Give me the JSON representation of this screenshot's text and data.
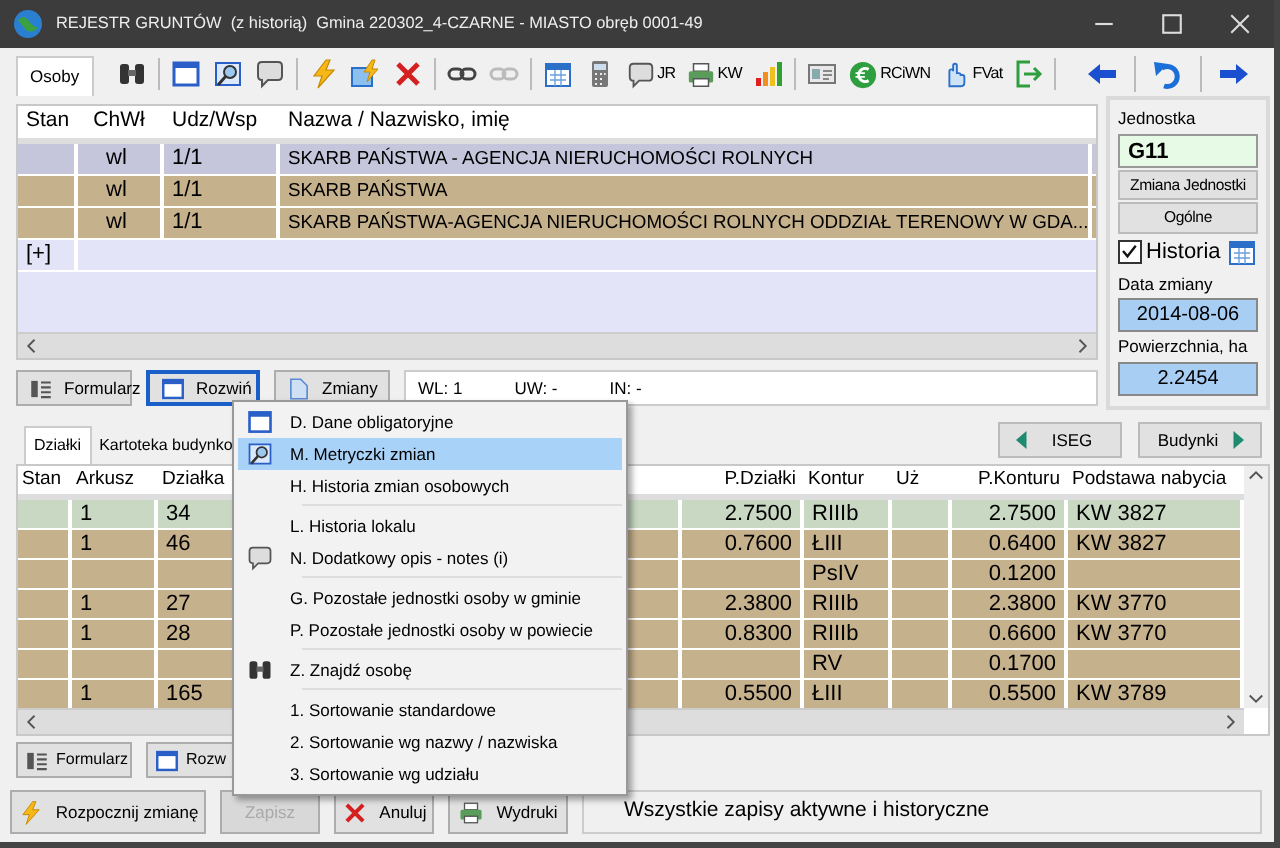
{
  "window": {
    "title": "REJESTR GRUNTÓW  (z historią)  Gmina 220302_4-CZARNE - MIASTO obręb 0001-49"
  },
  "tabs": [
    {
      "label": "Osoby",
      "selected": true
    }
  ],
  "toolbar": {
    "groups": [
      [
        {
          "kind": "binoculars",
          "disabled": false
        }
      ],
      [
        {
          "kind": "window",
          "disabled": false
        },
        {
          "kind": "magnifier",
          "disabled": false
        },
        {
          "kind": "bubble",
          "disabled": false
        }
      ],
      [
        {
          "kind": "bolt",
          "disabled": false
        },
        {
          "kind": "boltwin",
          "disabled": false
        },
        {
          "kind": "cross",
          "disabled": false
        }
      ],
      [
        {
          "kind": "link",
          "disabled": false
        },
        {
          "kind": "link",
          "disabled": true
        }
      ],
      [
        {
          "kind": "calendar",
          "disabled": false
        },
        {
          "kind": "calculator",
          "disabled": false
        },
        {
          "kind": "bubble",
          "label": "JR",
          "disabled": false
        },
        {
          "kind": "printer",
          "label": "KW",
          "disabled": false
        },
        {
          "kind": "chart",
          "disabled": false
        }
      ],
      [
        {
          "kind": "card",
          "disabled": false
        },
        {
          "kind": "euro",
          "label": "RCiWN",
          "disabled": false
        },
        {
          "kind": "hand",
          "label": "FVat",
          "disabled": false
        },
        {
          "kind": "exit",
          "disabled": false
        }
      ]
    ],
    "nav": [
      {
        "kind": "back",
        "disabled": false
      },
      {
        "kind": "undo",
        "disabled": false
      },
      {
        "kind": "forward",
        "disabled": false
      }
    ]
  },
  "owners": {
    "columns": [
      "Stan",
      "ChWł",
      "Udz/Wsp",
      "Nazwa / Nazwisko, imię"
    ],
    "rows": [
      {
        "right": "wl",
        "share": "1/1",
        "name": "SKARB PAŃSTWA - AGENCJA NIERUCHOMOŚCI ROLNYCH",
        "selected": true
      },
      {
        "right": "wl",
        "share": "1/1",
        "name": "SKARB PAŃSTWA",
        "selected": false
      },
      {
        "right": "wl",
        "share": "1/1",
        "name": "SKARB PAŃSTWA-AGENCJA NIERUCHOMOŚCI ROLNYCH ODDZIAŁ TERENOWY W GDA...",
        "selected": false
      }
    ],
    "add_row": "[+]"
  },
  "owner_buttons": [
    {
      "label": "Formularz",
      "kind": "form",
      "focused": false
    },
    {
      "label": "Rozwiń",
      "kind": "window",
      "focused": true
    },
    {
      "label": "Zmiany",
      "kind": "doc",
      "focused": false
    }
  ],
  "counters": [
    "WL: 1",
    "UW: -",
    "IN: -"
  ],
  "unit_panel": {
    "unit_label": "Jednostka",
    "unit_value": "G11",
    "change_unit_button": "Zmiana Jednostki",
    "general_button": "Ogólne",
    "history": {
      "label": "Historia",
      "checked": true
    },
    "change_date_label": "Data zmiany",
    "change_date": "2014-08-06",
    "area_label": "Powierzchnia, ha",
    "area": "2.2454"
  },
  "lower_tabs": [
    {
      "label": "Działki",
      "selected": true
    },
    {
      "label": "Kartoteka budynko",
      "selected": false
    }
  ],
  "lower_nav": [
    {
      "label": "ISEG",
      "kind": "left"
    },
    {
      "label": "Budynki",
      "kind": "right"
    }
  ],
  "parcels": {
    "columns": [
      "Stan",
      "Arkusz",
      "Działka",
      "P.Działki",
      "Kontur",
      "Uż",
      "P.Konturu",
      "Podstawa nabycia"
    ],
    "rows": [
      {
        "sheet": "1",
        "parcel": "34",
        "parcel_area": "2.7500",
        "contour": "RIIIb",
        "contour_area": "2.7500",
        "basis": "KW 3827",
        "selected": true
      },
      {
        "sheet": "1",
        "parcel": "46",
        "parcel_area": "0.7600",
        "contour": "ŁIII",
        "contour_area": "0.6400",
        "basis": "KW 3827",
        "selected": false
      },
      {
        "contour": "PsIV",
        "contour_area": "0.1200",
        "selected": false
      },
      {
        "sheet": "1",
        "parcel": "27",
        "parcel_area": "2.3800",
        "contour": "RIIIb",
        "contour_area": "2.3800",
        "basis": "KW 3770",
        "selected": false
      },
      {
        "sheet": "1",
        "parcel": "28",
        "parcel_area": "0.8300",
        "contour": "RIIIb",
        "contour_area": "0.6600",
        "basis": "KW 3770",
        "selected": false
      },
      {
        "contour": "RV",
        "contour_area": "0.1700",
        "selected": false
      },
      {
        "sheet": "1",
        "parcel": "165",
        "parcel_area": "0.5500",
        "contour": "ŁIII",
        "contour_area": "0.5500",
        "basis": "KW 3789",
        "selected": false
      }
    ]
  },
  "parcel_buttons": [
    {
      "label": "Formularz",
      "kind": "form"
    },
    {
      "label": "Rozw",
      "kind": "window"
    }
  ],
  "bottom_buttons": [
    {
      "label": "Rozpocznij zmianę",
      "kind": "bolt",
      "disabled": false
    },
    {
      "label": "Zapisz",
      "disabled": true
    },
    {
      "label": "Anuluj",
      "kind": "cross",
      "disabled": false
    },
    {
      "label": "Wydruki",
      "kind": "printer",
      "disabled": false
    }
  ],
  "status_bar": "Wszystkie zapisy aktywne i historyczne",
  "context_menu": {
    "groups": [
      [
        {
          "label": "D. Dane obligatoryjne",
          "kind": "window",
          "selected": false
        },
        {
          "label": "M. Metryczki zmian",
          "kind": "magnifier",
          "selected": true
        },
        {
          "label": "H. Historia zmian osobowych",
          "selected": false
        }
      ],
      [
        {
          "label": "L. Historia lokalu",
          "selected": false
        },
        {
          "label": "N. Dodatkowy opis - notes (i)",
          "kind": "bubble",
          "selected": false
        }
      ],
      [
        {
          "label": "G. Pozostałe jednostki osoby w gminie",
          "selected": false
        },
        {
          "label": "P. Pozostałe jednostki osoby w powiecie",
          "selected": false
        }
      ],
      [
        {
          "label": "Z. Znajdź osobę",
          "kind": "binoculars",
          "selected": false
        }
      ],
      [
        {
          "label": "1. Sortowanie standardowe",
          "selected": false
        },
        {
          "label": "2. Sortowanie wg nazwy / nazwiska",
          "selected": false
        },
        {
          "label": "3. Sortowanie wg udziału",
          "selected": false
        }
      ]
    ]
  }
}
